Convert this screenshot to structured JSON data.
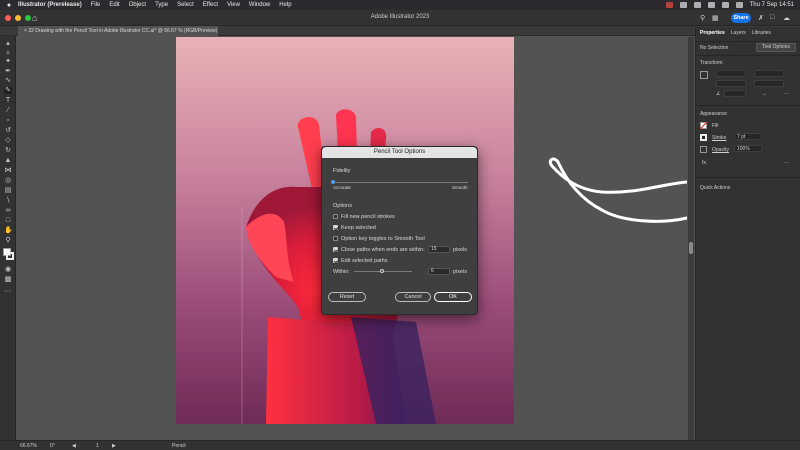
{
  "menubar": {
    "apple": "",
    "items": [
      "Illustrator (Prerelease)",
      "File",
      "Edit",
      "Object",
      "Type",
      "Select",
      "Effect",
      "View",
      "Window",
      "Help"
    ],
    "clock": "Thu 7 Sep  14:51"
  },
  "appbar": {
    "title": "Adobe Illustrator 2023",
    "share_label": "Share"
  },
  "document": {
    "tab_label": "32 Drawing with the Pencil Tool in Adobe Illustrator CC.ai* @ 66.67 % (RGB/Preview)"
  },
  "panel": {
    "tabs": [
      "Properties",
      "Layers",
      "Libraries"
    ],
    "selection": "No Selection",
    "tool_options_label": "Tool Options",
    "transform_heading": "Transform",
    "appearance_heading": "Appearance",
    "fill_label": "Fill",
    "stroke_label": "Stroke",
    "stroke_value": "7 pt",
    "opacity_label": "Opacity",
    "opacity_value": "100%",
    "fx_label": "fx.",
    "quick_actions_heading": "Quick Actions"
  },
  "status": {
    "zoom": "66.67%",
    "rotation": "0°",
    "artboard_number": "1",
    "tool_name": "Pencil"
  },
  "dialog": {
    "title": "Pencil Tool Options",
    "fidelity_label": "Fidelity",
    "fidelity_min": "Accurate",
    "fidelity_max": "Smooth",
    "fidelity_value": 0.0,
    "options_heading": "Options",
    "fill_strokes_label": "Fill new pencil strokes",
    "fill_strokes_checked": false,
    "keep_selected_label": "Keep selected",
    "keep_selected_checked": true,
    "option_key_label": "Option key toggles to Smooth Tool",
    "option_key_checked": false,
    "close_paths_label": "Close paths when ends are within:",
    "close_paths_checked": true,
    "close_paths_value": "15",
    "close_paths_unit": "pixels",
    "edit_paths_label": "Edit selected paths",
    "edit_paths_checked": true,
    "within_label": "Within:",
    "within_value": "6",
    "within_unit": "pixels",
    "within_fraction": 0.5,
    "reset_label": "Reset",
    "cancel_label": "Cancel",
    "ok_label": "OK"
  },
  "colors": {
    "accent": "#1473e6",
    "dialog_bg": "#3f3f3f",
    "chrome": "#323232"
  }
}
